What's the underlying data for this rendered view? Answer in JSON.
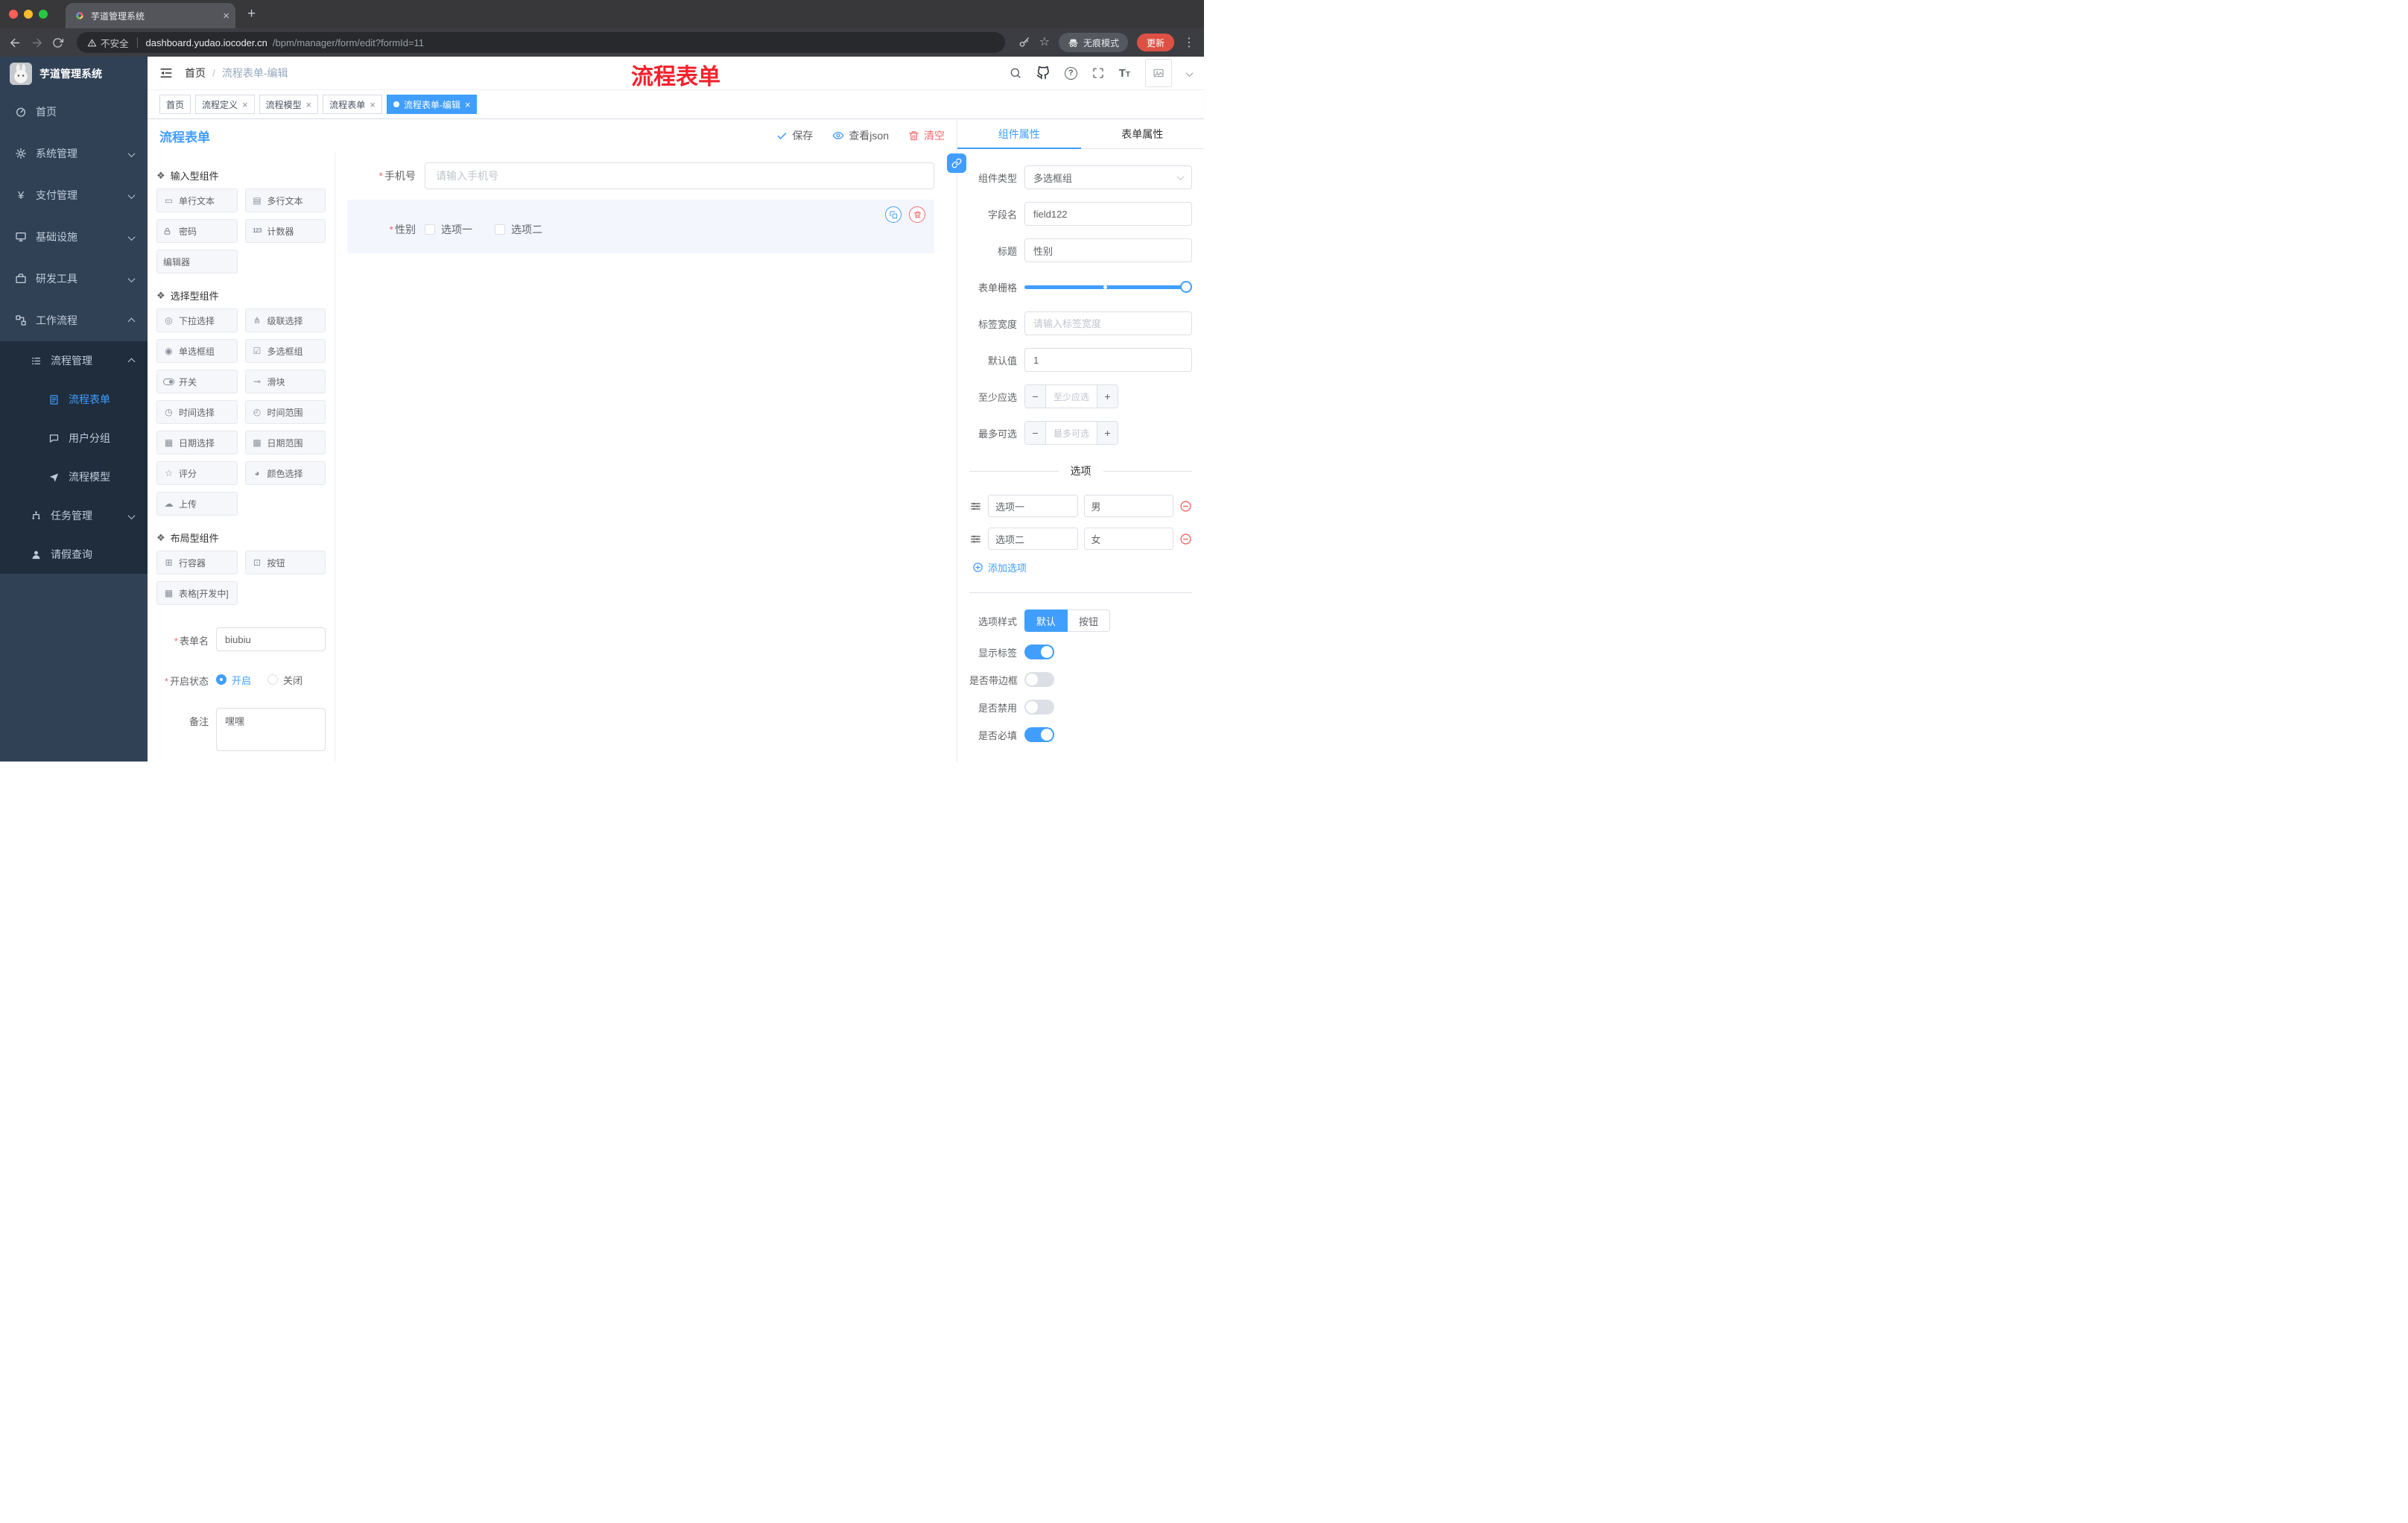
{
  "colors": {
    "accent": "#409EFF",
    "danger": "#F56C6C",
    "annotation": "#F5222D",
    "sidebar_bg": "#304156",
    "submenu_bg": "#1F2D3D"
  },
  "browser": {
    "tab_title": "芋道管理系统",
    "security_label": "不安全",
    "url_host": "dashboard.yudao.iocoder.cn",
    "url_path": "/bpm/manager/form/edit?formId=11",
    "incognito_label": "无痕模式",
    "update_label": "更新"
  },
  "sidebar": {
    "logo_title": "芋道管理系统",
    "items": [
      {
        "label": "首页"
      },
      {
        "label": "系统管理"
      },
      {
        "label": "支付管理"
      },
      {
        "label": "基础设施"
      },
      {
        "label": "研发工具"
      },
      {
        "label": "工作流程"
      },
      {
        "label": "流程管理"
      },
      {
        "label": "流程表单"
      },
      {
        "label": "用户分组"
      },
      {
        "label": "流程模型"
      },
      {
        "label": "任务管理"
      },
      {
        "label": "请假查询"
      }
    ]
  },
  "header": {
    "breadcrumb_root": "首页",
    "breadcrumb_current": "流程表单-编辑",
    "annotation": "流程表单"
  },
  "tags": [
    {
      "label": "首页"
    },
    {
      "label": "流程定义"
    },
    {
      "label": "流程模型"
    },
    {
      "label": "流程表单"
    },
    {
      "label": "流程表单-编辑"
    }
  ],
  "designer": {
    "title": "流程表单",
    "toolbar": {
      "save": "保存",
      "view_json": "查看json",
      "clear": "清空"
    },
    "palette": {
      "sections": [
        {
          "title": "输入型组件",
          "items": [
            {
              "label": "单行文本"
            },
            {
              "label": "多行文本"
            },
            {
              "label": "密码"
            },
            {
              "label": "计数器"
            },
            {
              "label": "编辑器"
            }
          ]
        },
        {
          "title": "选择型组件",
          "items": [
            {
              "label": "下拉选择"
            },
            {
              "label": "级联选择"
            },
            {
              "label": "单选框组"
            },
            {
              "label": "多选框组"
            },
            {
              "label": "开关"
            },
            {
              "label": "滑块"
            },
            {
              "label": "时间选择"
            },
            {
              "label": "时间范围"
            },
            {
              "label": "日期选择"
            },
            {
              "label": "日期范围"
            },
            {
              "label": "评分"
            },
            {
              "label": "颜色选择"
            },
            {
              "label": "上传"
            }
          ]
        },
        {
          "title": "布局型组件",
          "items": [
            {
              "label": "行容器"
            },
            {
              "label": "按钮"
            },
            {
              "label": "表格[开发中]"
            }
          ]
        }
      ]
    },
    "meta": {
      "form_name_label": "表单名",
      "form_name_value": "biubiu",
      "status_label": "开启状态",
      "status_on": "开启",
      "status_off": "关闭",
      "remark_label": "备注",
      "remark_value": "嘿嘿"
    },
    "canvas": {
      "phone_label": "手机号",
      "phone_placeholder": "请输入手机号",
      "gender_label": "性别",
      "gender_options": [
        {
          "label": "选项一"
        },
        {
          "label": "选项二"
        }
      ]
    }
  },
  "props": {
    "tab_component": "组件属性",
    "tab_form": "表单属性",
    "type_label": "组件类型",
    "type_value": "多选框组",
    "field_label": "字段名",
    "field_value": "field122",
    "title_label": "标题",
    "title_value": "性别",
    "grid_label": "表单栅格",
    "label_width_label": "标签宽度",
    "label_width_placeholder": "请输入标签宽度",
    "default_label": "默认值",
    "default_value": "1",
    "min_label": "至少应选",
    "min_placeholder": "至少应选",
    "max_label": "最多可选",
    "max_placeholder": "最多可选",
    "options_divider": "选项",
    "options": [
      {
        "label": "选项一",
        "value": "男"
      },
      {
        "label": "选项二",
        "value": "女"
      }
    ],
    "add_option_label": "添加选项",
    "style_label": "选项样式",
    "style_default": "默认",
    "style_button": "按钮",
    "switch_show_label": "显示标签",
    "switch_border": "是否带边框",
    "switch_disabled": "是否禁用",
    "switch_required": "是否必填"
  }
}
